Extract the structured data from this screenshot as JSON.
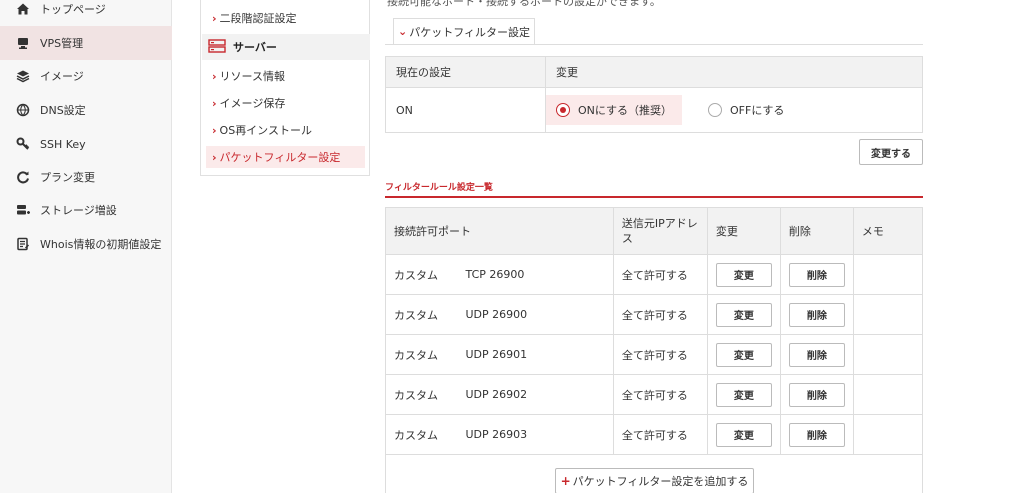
{
  "sidebar": {
    "items": [
      {
        "label": "トップページ",
        "icon": "home-icon"
      },
      {
        "label": "VPS管理",
        "icon": "server-icon"
      },
      {
        "label": "イメージ",
        "icon": "layers-icon"
      },
      {
        "label": "DNS設定",
        "icon": "globe-icon"
      },
      {
        "label": "SSH Key",
        "icon": "key-icon"
      },
      {
        "label": "プラン変更",
        "icon": "refresh-icon"
      },
      {
        "label": "ストレージ増設",
        "icon": "storage-icon"
      },
      {
        "label": "Whois情報の初期値設定",
        "icon": "document-icon"
      }
    ],
    "active_index": 1
  },
  "subnav": {
    "two_factor": "二段階認証設定",
    "section_label": "サーバー",
    "items": [
      "リソース情報",
      "イメージ保存",
      "OS再インストール",
      "パケットフィルター設定"
    ],
    "active_index": 3
  },
  "top_clip_text": "接続可能なポート・接続するポートの設定ができます。",
  "tab": {
    "label": "パケットフィルター設定"
  },
  "settings": {
    "col_current": "現在の設定",
    "col_change": "変更",
    "current_value": "ON",
    "option_on": "ONにする（推奨）",
    "option_off": "OFFにする",
    "selected": "on"
  },
  "change_button": "変更する",
  "rules_title": "フィルタールール設定一覧",
  "rules": {
    "headers": {
      "port": "接続許可ポート",
      "source": "送信元IPアドレス",
      "change": "変更",
      "delete": "削除",
      "memo": "メモ"
    },
    "rows": [
      {
        "type": "カスタム",
        "port": "TCP 26900",
        "source": "全て許可する",
        "change": "変更",
        "delete": "削除",
        "memo": ""
      },
      {
        "type": "カスタム",
        "port": "UDP 26900",
        "source": "全て許可する",
        "change": "変更",
        "delete": "削除",
        "memo": ""
      },
      {
        "type": "カスタム",
        "port": "UDP 26901",
        "source": "全て許可する",
        "change": "変更",
        "delete": "削除",
        "memo": ""
      },
      {
        "type": "カスタム",
        "port": "UDP 26902",
        "source": "全て許可する",
        "change": "変更",
        "delete": "削除",
        "memo": ""
      },
      {
        "type": "カスタム",
        "port": "UDP 26903",
        "source": "全て許可する",
        "change": "変更",
        "delete": "削除",
        "memo": ""
      }
    ]
  },
  "add_button": "パケットフィルター設定を追加する",
  "colors": {
    "accent": "#c8282d",
    "active_bg": "#f1e3e3",
    "header_bg": "#f2f2f2"
  }
}
